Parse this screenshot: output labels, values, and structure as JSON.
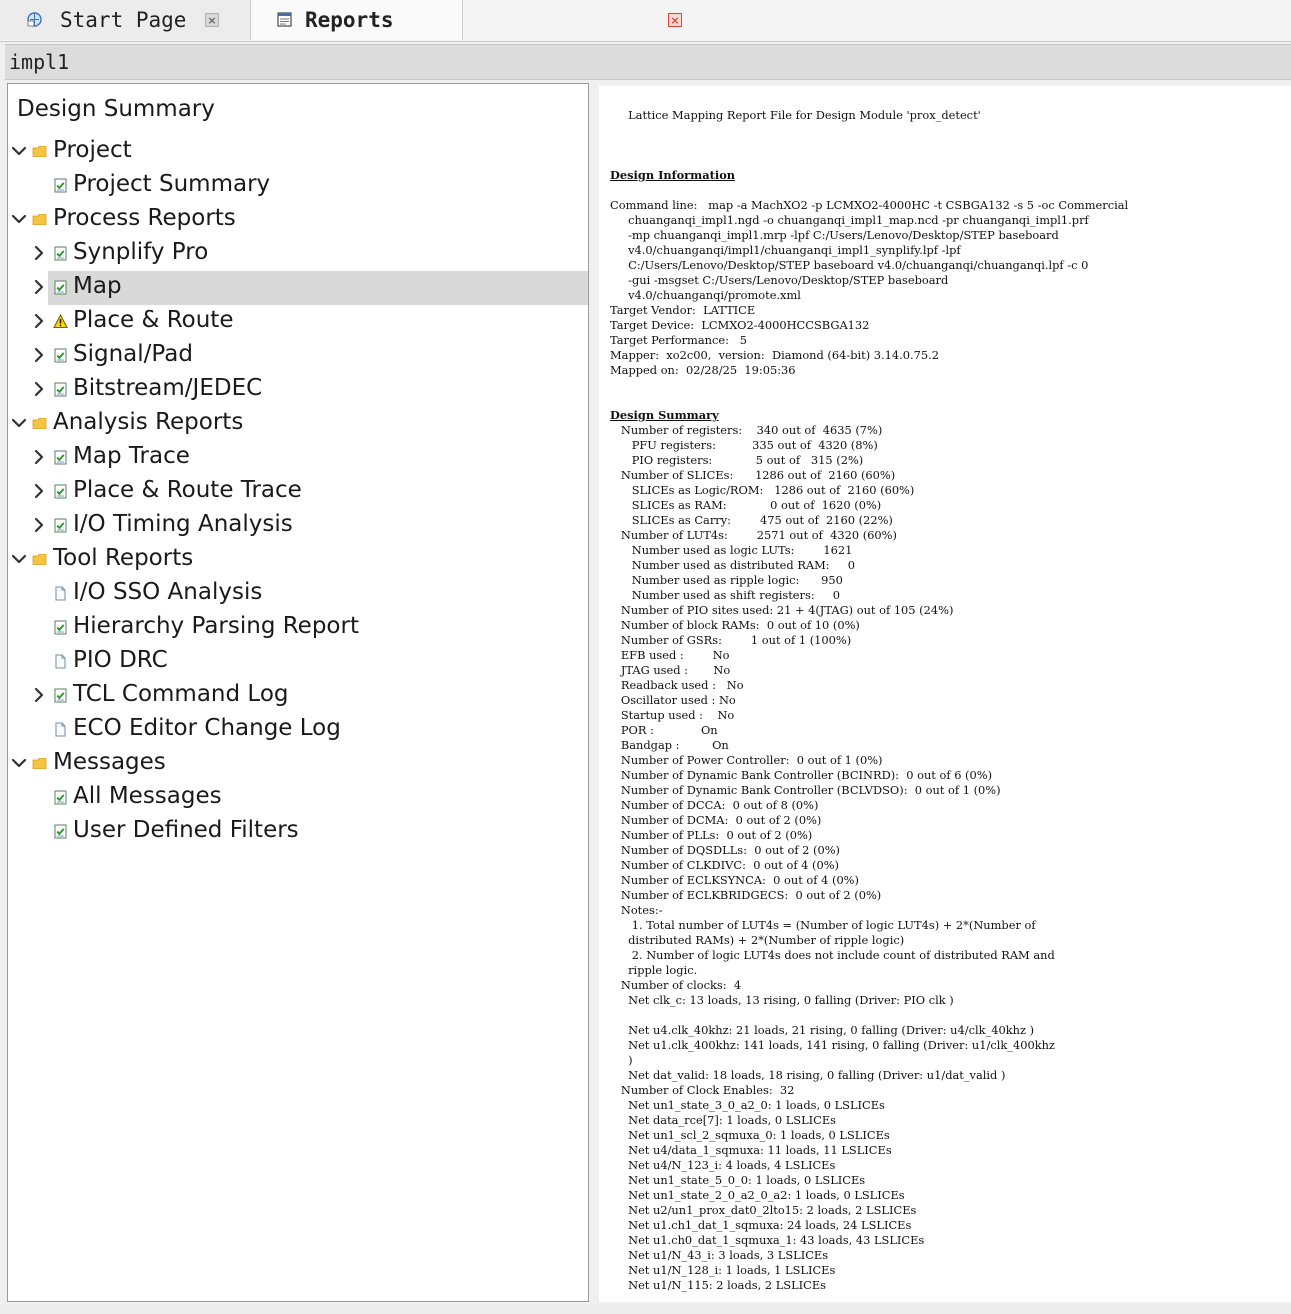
{
  "tabs": [
    {
      "label": "Start Page",
      "icon": "start-page-icon",
      "active": false
    },
    {
      "label": "Reports",
      "icon": "reports-icon",
      "active": true
    }
  ],
  "breadcrumb": "impl1",
  "tree": {
    "header": "Design Summary",
    "items": [
      {
        "label": "Project",
        "level": 0,
        "expanded": true,
        "icon": "folder-icon"
      },
      {
        "label": "Project Summary",
        "level": 1,
        "icon": "report-ok-icon"
      },
      {
        "label": "Process Reports",
        "level": 0,
        "expanded": true,
        "icon": "folder-icon"
      },
      {
        "label": "Synplify Pro",
        "level": 1,
        "collapsed": true,
        "icon": "report-ok-icon"
      },
      {
        "label": "Map",
        "level": 1,
        "collapsed": true,
        "icon": "report-ok-icon",
        "selected": true
      },
      {
        "label": "Place & Route",
        "level": 1,
        "collapsed": true,
        "icon": "warning-icon"
      },
      {
        "label": "Signal/Pad",
        "level": 1,
        "collapsed": true,
        "icon": "report-ok-icon"
      },
      {
        "label": "Bitstream/JEDEC",
        "level": 1,
        "collapsed": true,
        "icon": "report-ok-icon"
      },
      {
        "label": "Analysis Reports",
        "level": 0,
        "expanded": true,
        "icon": "folder-icon"
      },
      {
        "label": "Map Trace",
        "level": 1,
        "collapsed": true,
        "icon": "report-ok-icon"
      },
      {
        "label": "Place & Route Trace",
        "level": 1,
        "collapsed": true,
        "icon": "report-ok-icon"
      },
      {
        "label": "I/O Timing Analysis",
        "level": 1,
        "collapsed": true,
        "icon": "report-ok-icon"
      },
      {
        "label": "Tool Reports",
        "level": 0,
        "expanded": true,
        "icon": "folder-icon"
      },
      {
        "label": "I/O SSO Analysis",
        "level": 1,
        "icon": "document-icon"
      },
      {
        "label": "Hierarchy Parsing Report",
        "level": 1,
        "icon": "report-ok-icon"
      },
      {
        "label": "PIO DRC",
        "level": 1,
        "icon": "document-icon"
      },
      {
        "label": "TCL Command Log",
        "level": 1,
        "collapsed": true,
        "icon": "report-ok-icon"
      },
      {
        "label": "ECO Editor Change Log",
        "level": 1,
        "icon": "document-icon"
      },
      {
        "label": "Messages",
        "level": 0,
        "expanded": true,
        "icon": "folder-icon"
      },
      {
        "label": "All Messages",
        "level": 1,
        "icon": "report-ok-icon"
      },
      {
        "label": "User Defined Filters",
        "level": 1,
        "icon": "report-ok-icon"
      }
    ]
  },
  "report": {
    "title": "     Lattice Mapping Report File for Design Module 'prox_detect'",
    "design_info_header": "Design Information",
    "design_info": "Command line:   map -a MachXO2 -p LCMXO2-4000HC -t CSBGA132 -s 5 -oc Commercial\n     chuanganqi_impl1.ngd -o chuanganqi_impl1_map.ncd -pr chuanganqi_impl1.prf\n     -mp chuanganqi_impl1.mrp -lpf C:/Users/Lenovo/Desktop/STEP baseboard\n     v4.0/chuanganqi/impl1/chuanganqi_impl1_synplify.lpf -lpf\n     C:/Users/Lenovo/Desktop/STEP baseboard v4.0/chuanganqi/chuanganqi.lpf -c 0\n     -gui -msgset C:/Users/Lenovo/Desktop/STEP baseboard\n     v4.0/chuanganqi/promote.xml\nTarget Vendor:  LATTICE\nTarget Device:  LCMXO2-4000HCCSBGA132\nTarget Performance:   5\nMapper:  xo2c00,  version:  Diamond (64-bit) 3.14.0.75.2\nMapped on:  02/28/25  19:05:36",
    "design_summary_header": "Design Summary",
    "design_summary": "   Number of registers:    340 out of  4635 (7%)\n      PFU registers:          335 out of  4320 (8%)\n      PIO registers:            5 out of   315 (2%)\n   Number of SLICEs:      1286 out of  2160 (60%)\n      SLICEs as Logic/ROM:   1286 out of  2160 (60%)\n      SLICEs as RAM:            0 out of  1620 (0%)\n      SLICEs as Carry:        475 out of  2160 (22%)\n   Number of LUT4s:        2571 out of  4320 (60%)\n      Number used as logic LUTs:        1621\n      Number used as distributed RAM:     0\n      Number used as ripple logic:      950\n      Number used as shift registers:     0\n   Number of PIO sites used: 21 + 4(JTAG) out of 105 (24%)\n   Number of block RAMs:  0 out of 10 (0%)\n   Number of GSRs:        1 out of 1 (100%)\n   EFB used :        No\n   JTAG used :       No\n   Readback used :   No\n   Oscillator used : No\n   Startup used :    No\n   POR :             On\n   Bandgap :         On\n   Number of Power Controller:  0 out of 1 (0%)\n   Number of Dynamic Bank Controller (BCINRD):  0 out of 6 (0%)\n   Number of Dynamic Bank Controller (BCLVDSO):  0 out of 1 (0%)\n   Number of DCCA:  0 out of 8 (0%)\n   Number of DCMA:  0 out of 2 (0%)\n   Number of PLLs:  0 out of 2 (0%)\n   Number of DQSDLLs:  0 out of 2 (0%)\n   Number of CLKDIVC:  0 out of 4 (0%)\n   Number of ECLKSYNCA:  0 out of 4 (0%)\n   Number of ECLKBRIDGECS:  0 out of 2 (0%)\n   Notes:-\n      1. Total number of LUT4s = (Number of logic LUT4s) + 2*(Number of\n     distributed RAMs) + 2*(Number of ripple logic)\n      2. Number of logic LUT4s does not include count of distributed RAM and\n     ripple logic.\n   Number of clocks:  4\n     Net clk_c: 13 loads, 13 rising, 0 falling (Driver: PIO clk )\n\n     Net u4.clk_40khz: 21 loads, 21 rising, 0 falling (Driver: u4/clk_40khz )\n     Net u1.clk_400khz: 141 loads, 141 rising, 0 falling (Driver: u1/clk_400khz\n     )\n     Net dat_valid: 18 loads, 18 rising, 0 falling (Driver: u1/dat_valid )\n   Number of Clock Enables:  32\n     Net un1_state_3_0_a2_0: 1 loads, 0 LSLICEs\n     Net data_rce[7]: 1 loads, 0 LSLICEs\n     Net un1_scl_2_sqmuxa_0: 1 loads, 0 LSLICEs\n     Net u4/data_1_sqmuxa: 11 loads, 11 LSLICEs\n     Net u4/N_123_i: 4 loads, 4 LSLICEs\n     Net un1_state_5_0_0: 1 loads, 0 LSLICEs\n     Net un1_state_2_0_a2_0_a2: 1 loads, 0 LSLICEs\n     Net u2/un1_prox_dat0_2lto15: 2 loads, 2 LSLICEs\n     Net u1.ch1_dat_1_sqmuxa: 24 loads, 24 LSLICEs\n     Net u1.ch0_dat_1_sqmuxa_1: 43 loads, 43 LSLICEs\n     Net u1/N_43_i: 3 loads, 3 LSLICEs\n     Net u1/N_128_i: 1 loads, 1 LSLICEs\n     Net u1/N_115: 2 loads, 2 LSLICEs"
  }
}
